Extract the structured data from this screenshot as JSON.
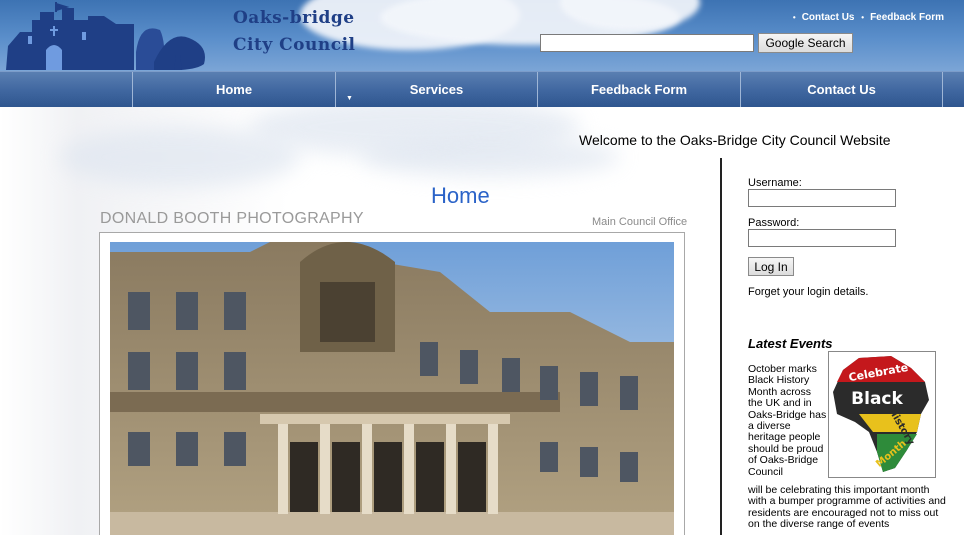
{
  "header": {
    "site_name_line1": "Oaks-bridge",
    "site_name_line2": "City Council",
    "top_links": [
      "Contact Us",
      "Feedback Form"
    ],
    "search": {
      "value": "",
      "button_label": "Google Search"
    }
  },
  "nav": {
    "items": [
      {
        "label": "Home"
      },
      {
        "label": "Services",
        "has_dropdown": true
      },
      {
        "label": "Feedback Form"
      },
      {
        "label": "Contact Us"
      }
    ]
  },
  "welcome_text": "Welcome to the Oaks-Bridge City Council Website",
  "main": {
    "title": "Home",
    "photo_credit": "DONALD BOOTH PHOTOGRAPHY",
    "photo_caption": "Main Council Office"
  },
  "sidebar": {
    "login": {
      "username_label": "Username:",
      "username_value": "",
      "password_label": "Password:",
      "password_value": "",
      "button_label": "Log In",
      "forgot_text": "Forget your login details."
    },
    "events": {
      "heading": "Latest Events",
      "text_wrapped": "October marks Black History Month across the UK and in Oaks-Bridge has a diverse heritage people should be proud of Oaks-Bridge Council",
      "text_full": "will be celebrating this important month with a bumper programme of activities and residents are encouraged not to miss out on the diverse range of events",
      "image_words": [
        "Celebrate",
        "Black",
        "History",
        "Month"
      ]
    }
  },
  "colors": {
    "nav_bg": "#3f669f",
    "title_blue": "#2b63c8",
    "site_name": "#1f3f86"
  }
}
